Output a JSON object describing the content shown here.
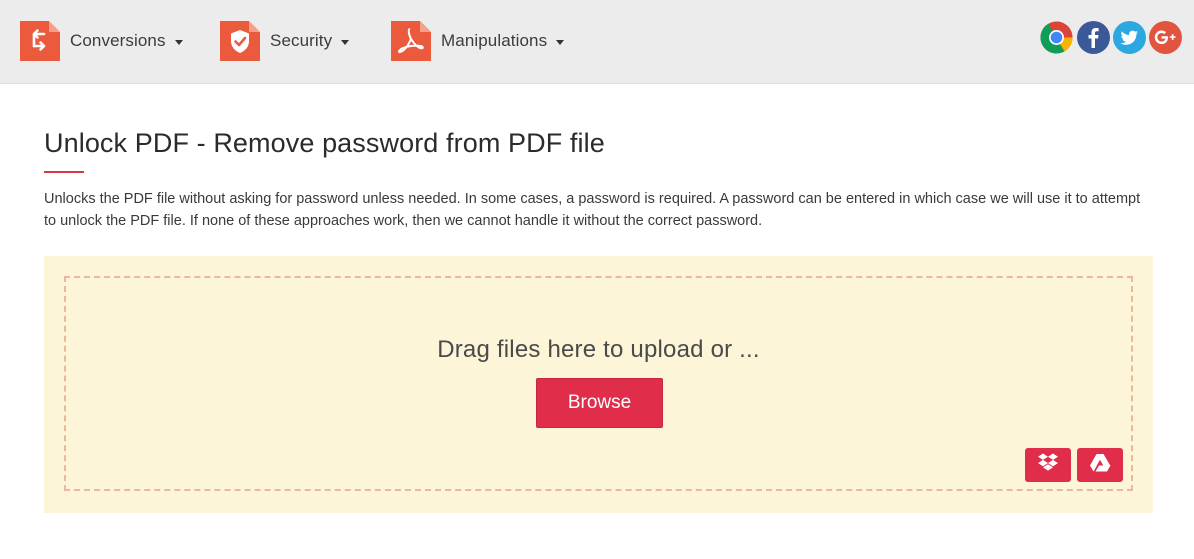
{
  "nav": {
    "items": [
      {
        "label": "Conversions",
        "icon": "arrows-exchange-icon"
      },
      {
        "label": "Security",
        "icon": "shield-check-icon"
      },
      {
        "label": "Manipulations",
        "icon": "pdf-acrobat-icon"
      }
    ],
    "social": [
      {
        "icon": "chrome-icon"
      },
      {
        "icon": "facebook-icon"
      },
      {
        "icon": "twitter-icon"
      },
      {
        "icon": "google-plus-icon"
      }
    ]
  },
  "page": {
    "title": "Unlock PDF - Remove password from PDF file",
    "description": "Unlocks the PDF file without asking for password unless needed. In some cases, a password is required. A password can be entered in which case we will use it to attempt to unlock the PDF file. If none of these approaches work, then we cannot handle it without the correct password."
  },
  "upload": {
    "drop_text": "Drag files here to upload or ...",
    "browse_label": "Browse",
    "cloud_buttons": [
      {
        "icon": "dropbox-icon"
      },
      {
        "icon": "google-drive-icon"
      }
    ]
  },
  "colors": {
    "accent": "#df2d4a",
    "nav_icon": "#ec5a3e",
    "panel_bg": "#fcf5d8",
    "dash_border": "#e9b99a",
    "topbar_bg": "#ececec"
  }
}
